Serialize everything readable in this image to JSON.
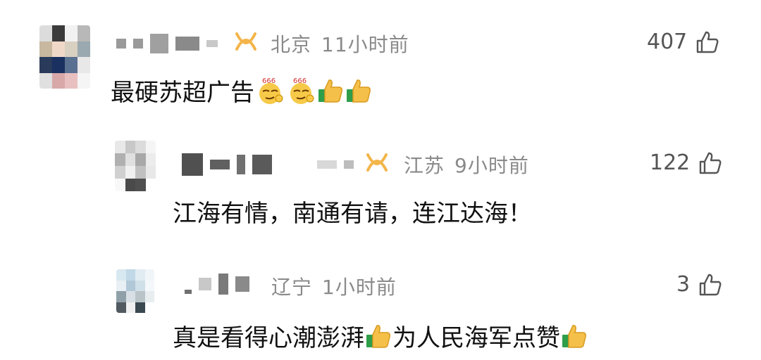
{
  "comments": [
    {
      "location": "北京",
      "time": "11小时前",
      "likes": "407",
      "text": "最硬苏超广告",
      "emoji": [
        "666-emoji",
        "666-emoji",
        "thumbs-up-emoji",
        "thumbs-up-emoji"
      ]
    },
    {
      "location": "江苏",
      "time": "9小时前",
      "likes": "122",
      "text": "江海有情，南通有请，连江达海！"
    },
    {
      "location": "辽宁",
      "time": "1小时前",
      "likes": "3",
      "text_part1": "真是看得心潮澎湃",
      "text_part2": "为人民海军点赞"
    }
  ],
  "colors": {
    "meta": "#8a8a8a",
    "vip_badge": "#f3b54a",
    "text": "#111111"
  },
  "emoji_label": "666"
}
